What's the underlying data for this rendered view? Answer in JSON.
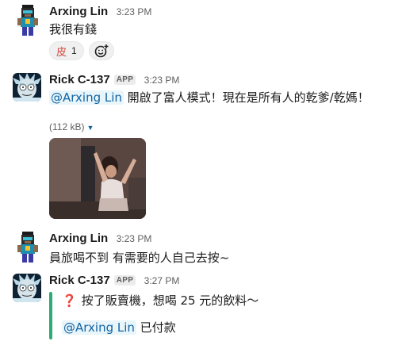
{
  "messages": [
    {
      "author": "Arxing Lin",
      "time": "3:23 PM",
      "text": "我很有錢",
      "reaction": {
        "emoji": "皮",
        "count": "1"
      },
      "add_reaction_icon": "add-emoji-icon"
    },
    {
      "author": "Rick C-137",
      "badge": "APP",
      "time": "3:23 PM",
      "mention": "@Arxing Lin",
      "text": " 開啟了富人模式！現在是所有人的乾爹/乾媽！",
      "attachment_size": "(112 kB)",
      "caret_icon": "chevron-down-icon"
    },
    {
      "author": "Arxing Lin",
      "time": "3:23 PM",
      "text": "員旅喝不到 有需要的人自己去按~"
    },
    {
      "author": "Rick C-137",
      "badge": "APP",
      "time": "3:27 PM",
      "question_icon": "question-mark-icon",
      "quote_text": "按了販賣機，想喝 25 元的飲料～",
      "mention": "@Arxing Lin",
      "paid_text": " 已付款"
    }
  ],
  "colors": {
    "mention_text": "#1264a3",
    "mention_bg": "#e8f5fa",
    "quote_bar": "#2bac76",
    "reaction_emoji": "#d4463a"
  }
}
